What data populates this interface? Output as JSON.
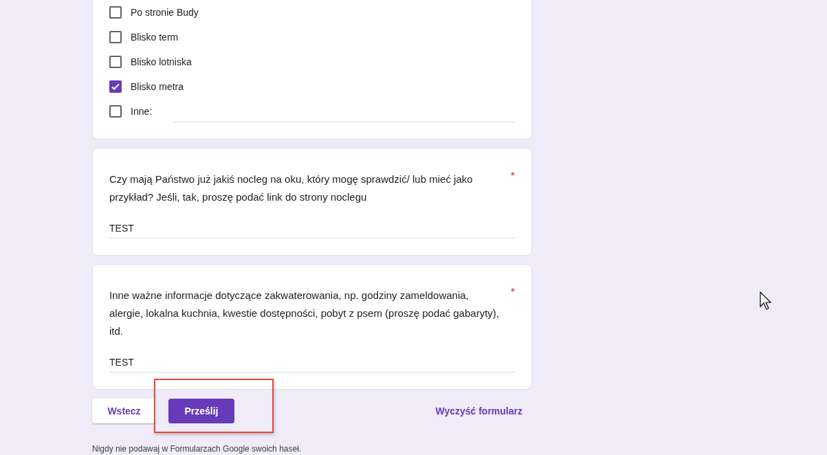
{
  "options": [
    {
      "label": "Po stronie Budy",
      "checked": false,
      "kind": "plain"
    },
    {
      "label": "Blisko term",
      "checked": false,
      "kind": "plain"
    },
    {
      "label": "Blisko lotniska",
      "checked": false,
      "kind": "plain"
    },
    {
      "label": "Blisko metra",
      "checked": true,
      "kind": "plain"
    },
    {
      "label": "Inne:",
      "checked": false,
      "kind": "other"
    }
  ],
  "questions": [
    {
      "text": "Czy mają Państwo już jakiś nocleg na oku, który mogę sprawdzić/ lub mieć jako przykład? Jeśli, tak, proszę podać link do strony noclegu",
      "required_mark": "*",
      "answer": "TEST"
    },
    {
      "text": "Inne ważne informacje dotyczące zakwaterowania, np.  godziny zameldowania, alergie, lokalna kuchnia, kwestie dostępności, pobyt z psem (proszę podać gabaryty), itd.",
      "required_mark": "*",
      "answer": "TEST"
    }
  ],
  "buttons": {
    "back": "Wstecz",
    "submit": "Prześlij",
    "clear": "Wyczyść formularz"
  },
  "footer": "Nigdy nie podawaj w Formularzach Google swoich haseł."
}
